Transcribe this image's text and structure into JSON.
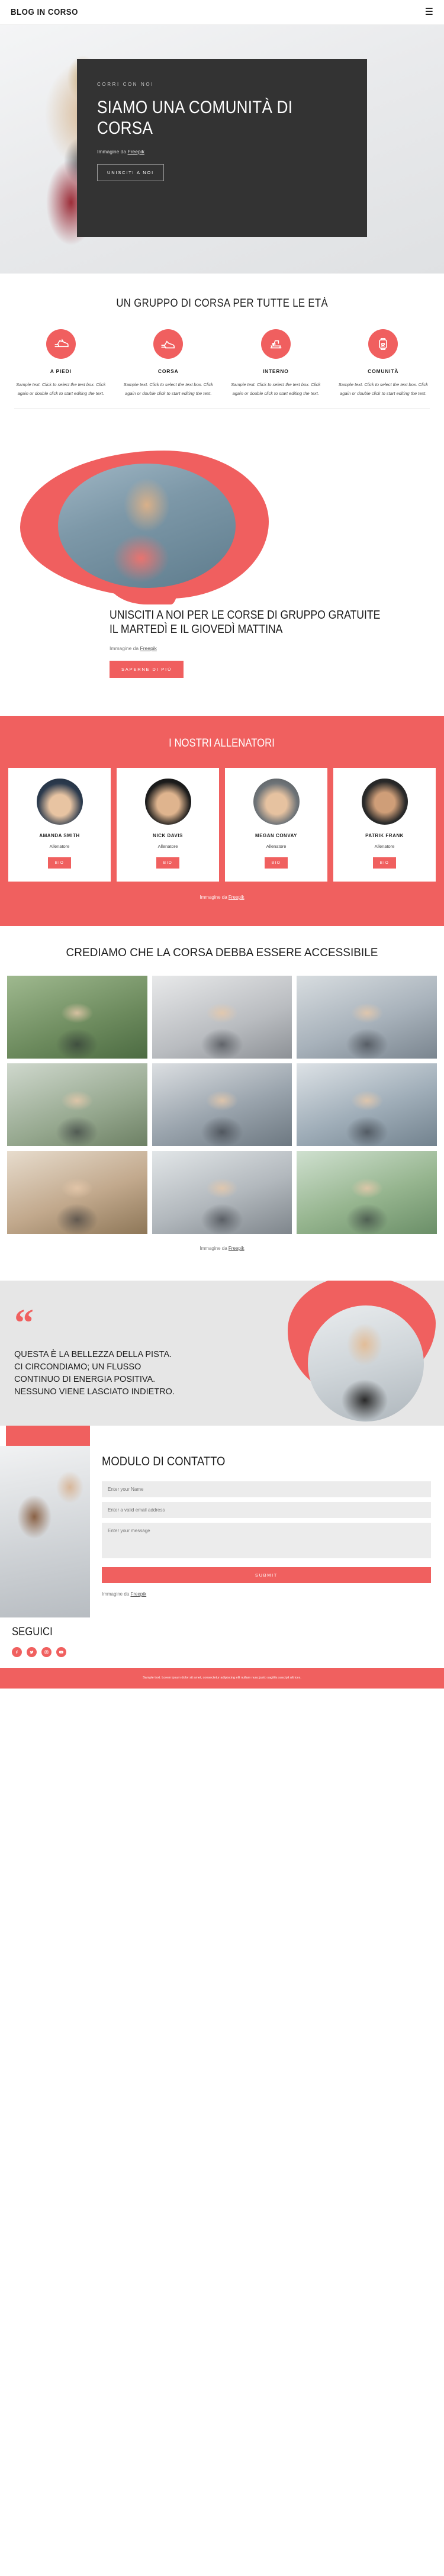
{
  "header": {
    "logo": "BLOG IN CORSO",
    "menu_icon": "hamburger-icon"
  },
  "hero": {
    "eyebrow": "CORRI CON NOI",
    "title": "SIAMO UNA COMUNITÀ DI CORSA",
    "credit_prefix": "Immagine da ",
    "credit_link": "Freepik",
    "cta": "UNISCITI A NOI"
  },
  "features": {
    "title": "UN GRUPPO DI CORSA PER TUTTE LE ETÀ",
    "items": [
      {
        "icon": "running-shoe-icon",
        "name": "A PIEDI",
        "desc": "Sample text. Click to select the text box. Click again or double click to start editing the text."
      },
      {
        "icon": "sneaker-icon",
        "name": "CORSA",
        "desc": "Sample text. Click to select the text box. Click again or double click to start editing the text."
      },
      {
        "icon": "exercise-bike-icon",
        "name": "INTERNO",
        "desc": "Sample text. Click to select the text box. Click again or double click to start editing the text."
      },
      {
        "icon": "smartwatch-heart-icon",
        "name": "COMUNITÀ",
        "desc": "Sample text. Click to select the text box. Click again or double click to start editing the text."
      }
    ]
  },
  "about": {
    "title": "UNISCITI A NOI PER LE CORSE DI GRUPPO GRATUITE IL MARTEDÌ E IL GIOVEDÌ MATTINA",
    "credit_prefix": "Immagine da ",
    "credit_link": "Freepik",
    "cta": "SAPERNE DI PIÙ"
  },
  "trainers": {
    "title": "I NOSTRI ALLENATORI",
    "cards": [
      {
        "name": "AMANDA SMITH",
        "role": "Allenatore",
        "button": "BIO"
      },
      {
        "name": "NICK DAVIS",
        "role": "Allenatore",
        "button": "BIO"
      },
      {
        "name": "MEGAN CONVAY",
        "role": "Allenatore",
        "button": "BIO"
      },
      {
        "name": "PATRIK FRANK",
        "role": "Allenatore",
        "button": "BIO"
      }
    ],
    "credit_prefix": "Immagine da ",
    "credit_link": "Freepik"
  },
  "gallery": {
    "title": "CREDIAMO CHE LA CORSA DEBBA ESSERE ACCESSIBILE",
    "credit_prefix": "Immagine da ",
    "credit_link": "Freepik",
    "photo_count": 9
  },
  "quote": {
    "mark": "“",
    "text": "QUESTA È LA BELLEZZA DELLA PISTA. CI CIRCONDIAMO; UN FLUSSO CONTINUO DI ENERGIA POSITIVA. NESSUNO VIENE LASCIATO INDIETRO."
  },
  "contact": {
    "title": "MODULO DI CONTATTO",
    "name_placeholder": "Enter your Name",
    "email_placeholder": "Enter a valid email address",
    "message_placeholder": "Enter your message",
    "submit": "Submit",
    "credit_prefix": "Immagine da ",
    "credit_link": "Freepik"
  },
  "follow": {
    "title": "SEGUICI",
    "socials": [
      "facebook-icon",
      "twitter-icon",
      "instagram-icon",
      "youtube-icon"
    ]
  },
  "footer": {
    "text": "Sample text. Lorem ipsum dolor sit amet, consectetur adipiscing elit nullam nunc justo sagittis suscipit ultrices."
  },
  "colors": {
    "accent": "#f0605f",
    "dark": "#333333",
    "grey": "#e6e6e6"
  }
}
